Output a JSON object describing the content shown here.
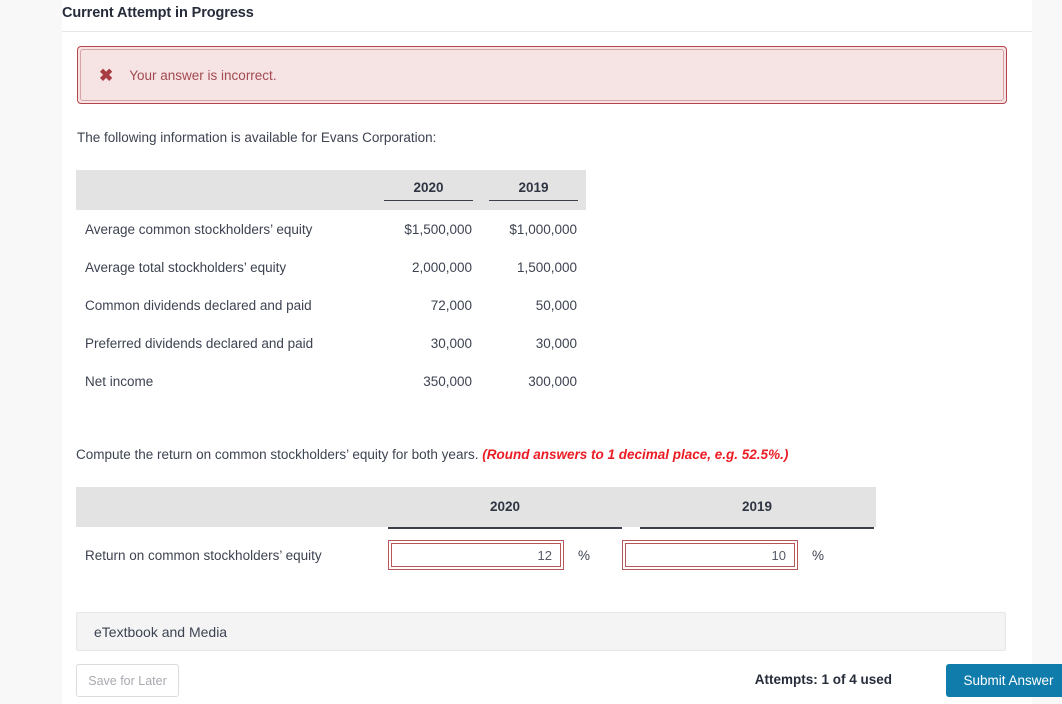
{
  "header": {
    "title": "Current Attempt in Progress"
  },
  "alert": {
    "icon": "x-mark-icon",
    "icon_glyph": "✖",
    "message": "Your answer is incorrect.",
    "border_color": "#b4454b",
    "background_color": "#f6e3e4",
    "text_color": "#a24a50"
  },
  "intro": {
    "text": "The following information is available for Evans Corporation:"
  },
  "fact_table": {
    "columns": [
      "",
      "2020",
      "2019"
    ],
    "rows": [
      {
        "label": "Average common stockholders’ equity",
        "y2020": "$1,500,000",
        "y2019": "$1,000,000"
      },
      {
        "label": "Average total stockholders’ equity",
        "y2020": "2,000,000",
        "y2019": "1,500,000"
      },
      {
        "label": "Common dividends declared and paid",
        "y2020": "72,000",
        "y2019": "50,000"
      },
      {
        "label": "Preferred dividends declared and paid",
        "y2020": "30,000",
        "y2019": "30,000"
      },
      {
        "label": "Net income",
        "y2020": "350,000",
        "y2019": "300,000"
      }
    ]
  },
  "compute": {
    "prompt": "Compute the return on common stockholders’ equity for both years.",
    "hint": "(Round answers to 1 decimal place, e.g. 52.5%.)",
    "hint_color": "#ec1c24"
  },
  "answer_table": {
    "columns": [
      "",
      "2020",
      "2019"
    ],
    "row_label": "Return on common stockholders’ equity",
    "inputs": [
      {
        "year": "2020",
        "value": "12",
        "placeholder": "",
        "unit": "%",
        "state": "incorrect"
      },
      {
        "year": "2019",
        "value": "10",
        "placeholder": "",
        "unit": "%",
        "state": "incorrect"
      }
    ],
    "input_border_color": "#b4585c"
  },
  "etextbook": {
    "label": "eTextbook and Media"
  },
  "footer": {
    "save_label": "Save for Later",
    "attempts_text": "Attempts: 1 of 4 used",
    "submit_label": "Submit Answer",
    "submit_color": "#0f7cab"
  }
}
